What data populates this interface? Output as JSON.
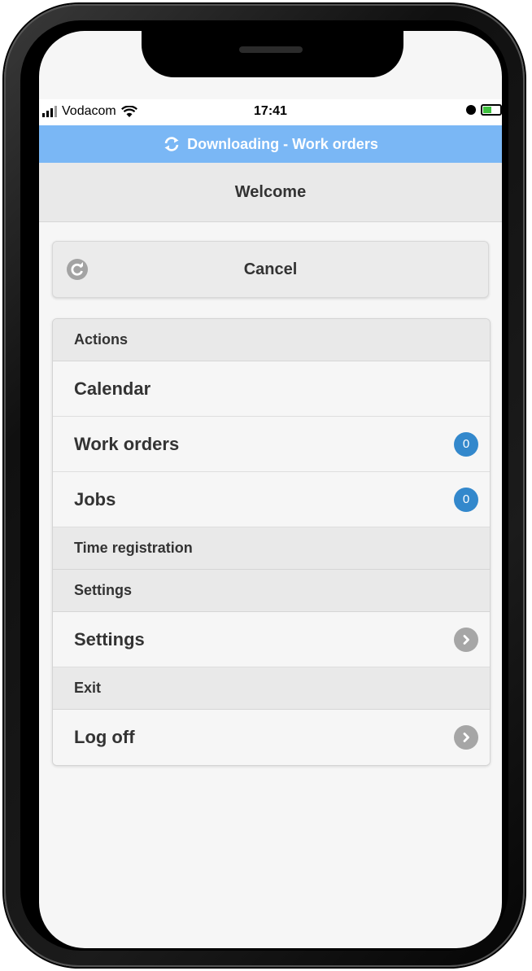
{
  "status_bar": {
    "carrier": "Vodacom",
    "time": "17:41"
  },
  "banner": {
    "text": "Downloading - Work orders",
    "icon": "sync-icon",
    "color": "#7ab7f5"
  },
  "header": {
    "title": "Welcome"
  },
  "cancel_button": {
    "label": "Cancel",
    "icon": "refresh-icon"
  },
  "menu": {
    "actions_label": "Actions",
    "calendar_label": "Calendar",
    "work_orders_label": "Work orders",
    "work_orders_count": "0",
    "jobs_label": "Jobs",
    "jobs_count": "0",
    "time_registration_label": "Time registration",
    "settings_section_label": "Settings",
    "settings_label": "Settings",
    "exit_label": "Exit",
    "log_off_label": "Log off"
  },
  "colors": {
    "badge": "#3388cc",
    "arrow": "#a6a6a6"
  }
}
